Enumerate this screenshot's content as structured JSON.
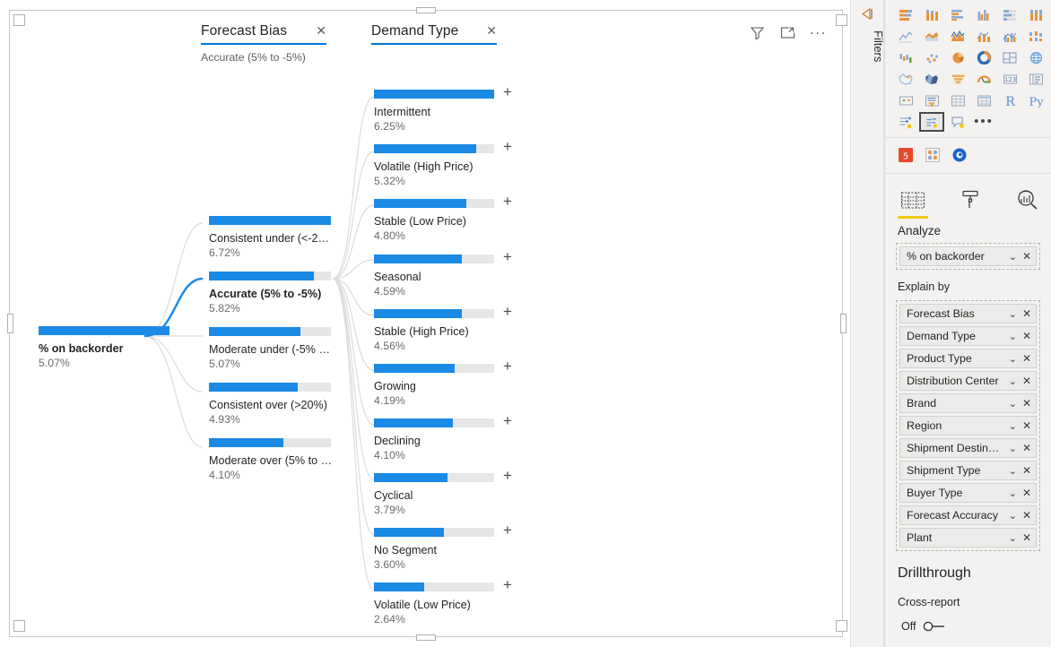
{
  "visual_header": {
    "filter_icon": "filter-funnel-icon",
    "focus_icon": "focus-mode-icon",
    "more_label": "..."
  },
  "filters_pane": {
    "label": "Filters",
    "expand_icon": "expand-pane-arrow-icon"
  },
  "tree": {
    "root": {
      "label": "% on backorder",
      "value": "5.07%",
      "fill_pct": 100
    },
    "levels": [
      {
        "title": "Forecast Bias",
        "subtitle": "Accurate (5% to -5%)",
        "close_label": "✕",
        "nodes": [
          {
            "label": "Consistent under (<-2…",
            "value": "6.72%",
            "fill_pct": 100,
            "selected": false,
            "expandable": false
          },
          {
            "label": "Accurate (5% to -5%)",
            "value": "5.82%",
            "fill_pct": 86,
            "selected": true,
            "expandable": false
          },
          {
            "label": "Moderate under (-5% …",
            "value": "5.07%",
            "fill_pct": 75,
            "selected": false,
            "expandable": false
          },
          {
            "label": "Consistent over (>20%)",
            "value": "4.93%",
            "fill_pct": 73,
            "selected": false,
            "expandable": false
          },
          {
            "label": "Moderate over (5% to …",
            "value": "4.10%",
            "fill_pct": 61,
            "selected": false,
            "expandable": false
          }
        ]
      },
      {
        "title": "Demand Type",
        "subtitle": "",
        "close_label": "✕",
        "nodes": [
          {
            "label": "Intermittent",
            "value": "6.25%",
            "fill_pct": 100,
            "selected": false,
            "expandable": true
          },
          {
            "label": "Volatile (High Price)",
            "value": "5.32%",
            "fill_pct": 85,
            "selected": false,
            "expandable": true
          },
          {
            "label": "Stable (Low Price)",
            "value": "4.80%",
            "fill_pct": 77,
            "selected": false,
            "expandable": true
          },
          {
            "label": "Seasonal",
            "value": "4.59%",
            "fill_pct": 73,
            "selected": false,
            "expandable": true
          },
          {
            "label": "Stable (High Price)",
            "value": "4.56%",
            "fill_pct": 73,
            "selected": false,
            "expandable": true
          },
          {
            "label": "Growing",
            "value": "4.19%",
            "fill_pct": 67,
            "selected": false,
            "expandable": true
          },
          {
            "label": "Declining",
            "value": "4.10%",
            "fill_pct": 66,
            "selected": false,
            "expandable": true
          },
          {
            "label": "Cyclical",
            "value": "3.79%",
            "fill_pct": 61,
            "selected": false,
            "expandable": true
          },
          {
            "label": "No Segment",
            "value": "3.60%",
            "fill_pct": 58,
            "selected": false,
            "expandable": true
          },
          {
            "label": "Volatile (Low Price)",
            "value": "2.64%",
            "fill_pct": 42,
            "selected": false,
            "expandable": true
          }
        ]
      }
    ],
    "expand_label": "+"
  },
  "viz_pane": {
    "gallery_icons": [
      "stacked-bar-chart-icon",
      "stacked-column-chart-icon",
      "clustered-bar-chart-icon",
      "clustered-column-chart-icon",
      "100-stacked-bar-chart-icon",
      "100-stacked-column-chart-icon",
      "line-chart-icon",
      "area-chart-icon",
      "stacked-area-chart-icon",
      "line-stacked-column-chart-icon",
      "line-clustered-column-chart-icon",
      "ribbon-chart-icon",
      "waterfall-chart-icon",
      "scatter-chart-icon",
      "pie-chart-icon",
      "donut-chart-icon",
      "treemap-icon",
      "map-icon",
      "filled-map-icon",
      "shape-map-icon",
      "funnel-chart-icon",
      "gauge-chart-icon",
      "card-icon",
      "multi-row-card-icon",
      "kpi-icon",
      "slicer-icon",
      "table-icon",
      "matrix-icon",
      "r-script-visual-icon",
      "python-visual-icon",
      "key-influencers-icon",
      "decomposition-tree-icon",
      "qa-visual-icon"
    ],
    "gallery_more_label": "•••",
    "selected_gallery_icon": "decomposition-tree-icon",
    "format_icons": [
      "html-content-icon",
      "custom-visual-icon",
      "power-bi-visual-icon"
    ],
    "tabs": [
      {
        "label": "Analyze",
        "icon": "fields-icon",
        "active": true
      },
      {
        "label": "",
        "icon": "format-paint-roller-icon",
        "active": false
      },
      {
        "label": "",
        "icon": "analytics-magnifier-icon",
        "active": false
      }
    ],
    "tabs_label": "Analyze",
    "analyze_field": {
      "name": "% on backorder",
      "caret": "⌄",
      "remove": "✕"
    },
    "explain_by_label": "Explain by",
    "explain_by_fields": [
      "Forecast Bias",
      "Demand Type",
      "Product Type",
      "Distribution Center",
      "Brand",
      "Region",
      "Shipment Destination",
      "Shipment Type",
      "Buyer Type",
      "Forecast Accuracy",
      "Plant"
    ],
    "chip_caret": "⌄",
    "chip_remove": "✕",
    "drillthrough": {
      "title": "Drillthrough",
      "subtitle": "Cross-report",
      "toggle_label": "Off",
      "toggle_state": "off"
    }
  },
  "colors": {
    "accent_blue": "#1a8ae5",
    "header_underline": "#0078d4",
    "bar_track": "#e6e6e6",
    "tab_highlight": "#f2c811",
    "pane_bg": "#f3f2f1"
  }
}
